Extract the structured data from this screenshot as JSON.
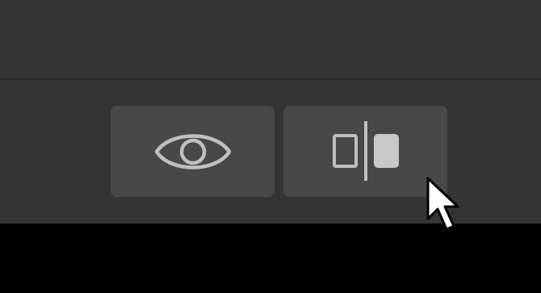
{
  "toolbar": {
    "buttons": [
      {
        "id": "preview",
        "icon": "eye-icon"
      },
      {
        "id": "compare",
        "icon": "split-view-icon"
      }
    ]
  },
  "colors": {
    "panel_background": "#353535",
    "button_background": "#484848",
    "icon_stroke": "#bfbfbf",
    "icon_fill": "#c8c8c8",
    "outer_background": "#000000"
  },
  "cursor": {
    "icon": "mouse-pointer-icon"
  }
}
